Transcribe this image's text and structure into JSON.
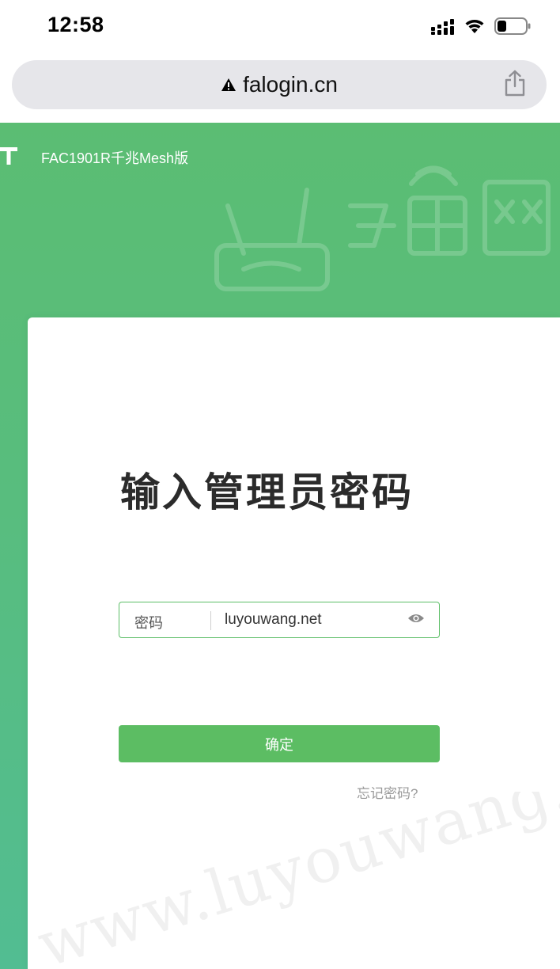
{
  "status_bar": {
    "time": "12:58"
  },
  "address_bar": {
    "url": "falogin.cn",
    "warning_icon": "warning-triangle-icon",
    "share_icon": "share-icon"
  },
  "header": {
    "model_name": "FAC1901R千兆Mesh版"
  },
  "login": {
    "title": "输入管理员密码",
    "password_label": "密码",
    "password_value": "luyouwang.net",
    "confirm_label": "确定",
    "forgot_label": "忘记密码?"
  },
  "watermark": {
    "text": "www.luyouwang.net"
  },
  "colors": {
    "accent_green": "#5cbd63",
    "header_green": "#5bbd73"
  }
}
